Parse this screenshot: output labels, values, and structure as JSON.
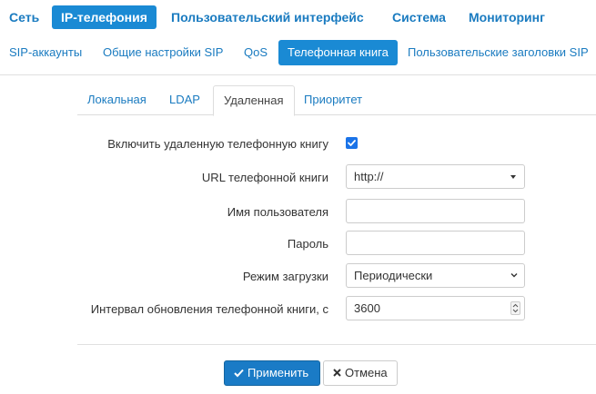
{
  "top_nav": {
    "items": [
      "Сеть",
      "IP-телефония",
      "Пользовательский интерфейс",
      "Система",
      "Мониторинг"
    ],
    "active_index": 1
  },
  "sub_nav": {
    "items": [
      "SIP-аккаунты",
      "Общие настройки SIP",
      "QoS",
      "Телефонная книга",
      "Пользовательские заголовки SIP"
    ],
    "active_index": 3
  },
  "tabs": {
    "items": [
      "Локальная",
      "LDAP",
      "Удаленная",
      "Приоритет"
    ],
    "active_index": 2
  },
  "form": {
    "enable_remote": {
      "label": "Включить удаленную телефонную книгу",
      "checked": true
    },
    "url": {
      "label": "URL телефонной книги",
      "value": "http://"
    },
    "username": {
      "label": "Имя пользователя",
      "value": ""
    },
    "password": {
      "label": "Пароль",
      "value": ""
    },
    "load_mode": {
      "label": "Режим загрузки",
      "value": "Периодически"
    },
    "update_interval": {
      "label": "Интервал обновления телефонной книги, с",
      "value": "3600"
    }
  },
  "buttons": {
    "apply": "Применить",
    "cancel": "Отмена"
  },
  "colors": {
    "accent": "#1a8ad4",
    "link": "#1a7bc0",
    "checkbox": "#1a73e8"
  }
}
